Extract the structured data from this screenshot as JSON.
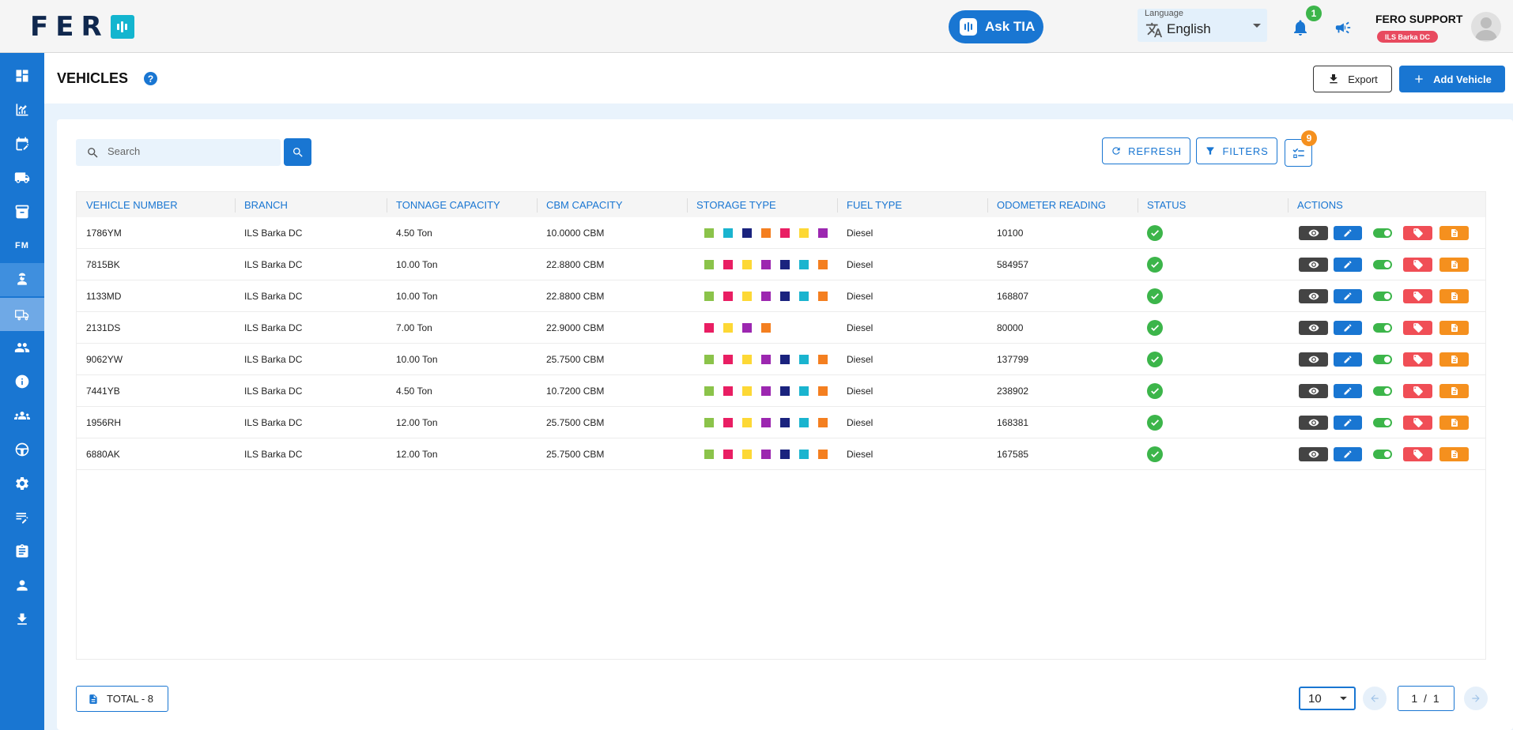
{
  "header": {
    "logo_text": "FER",
    "ask_label": "Ask TIA",
    "language_label": "Language",
    "language_value": "English",
    "notification_count": "1",
    "user_name": "FERO SUPPORT",
    "user_branch": "ILS Barka DC"
  },
  "sidebar": {
    "fm_label": "FM",
    "items": [
      "dashboard-icon",
      "analytics-icon",
      "planner-icon",
      "truck-icon",
      "archive-icon",
      "fm-icon",
      "driver-icon",
      "vehicle-icon",
      "users-icon",
      "info-icon",
      "groups-icon",
      "steering-wheel-icon",
      "settings-icon",
      "edit-note-icon",
      "clipboard-icon",
      "person-icon",
      "download-icon"
    ]
  },
  "page": {
    "title": "VEHICLES",
    "help": "?",
    "export_label": "Export",
    "add_label": "Add Vehicle"
  },
  "toolbar": {
    "search_placeholder": "Search",
    "refresh_label": "REFRESH",
    "filters_label": "FILTERS",
    "columns_badge": "9"
  },
  "table": {
    "columns": [
      "VEHICLE NUMBER",
      "BRANCH",
      "TONNAGE CAPACITY",
      "CBM CAPACITY",
      "STORAGE TYPE",
      "FUEL TYPE",
      "ODOMETER READING",
      "STATUS",
      "ACTIONS"
    ],
    "rows": [
      {
        "vehicle": "1786YM",
        "branch": "ILS Barka DC",
        "tonnage": "4.50 Ton",
        "cbm": "10.0000 CBM",
        "storage": [
          "#8bc34a",
          "#1ab4cf",
          "#1a237e",
          "#f47f20",
          "#e91e63",
          "#fdd835",
          "#9c27b0"
        ],
        "fuel": "Diesel",
        "odometer": "10100"
      },
      {
        "vehicle": "7815BK",
        "branch": "ILS Barka DC",
        "tonnage": "10.00 Ton",
        "cbm": "22.8800 CBM",
        "storage": [
          "#8bc34a",
          "#e91e63",
          "#fdd835",
          "#9c27b0",
          "#1a237e",
          "#1ab4cf",
          "#f47f20"
        ],
        "fuel": "Diesel",
        "odometer": "584957"
      },
      {
        "vehicle": "1133MD",
        "branch": "ILS Barka DC",
        "tonnage": "10.00 Ton",
        "cbm": "22.8800 CBM",
        "storage": [
          "#8bc34a",
          "#e91e63",
          "#fdd835",
          "#9c27b0",
          "#1a237e",
          "#1ab4cf",
          "#f47f20"
        ],
        "fuel": "Diesel",
        "odometer": "168807"
      },
      {
        "vehicle": "2131DS",
        "branch": "ILS Barka DC",
        "tonnage": "7.00 Ton",
        "cbm": "22.9000 CBM",
        "storage": [
          "#e91e63",
          "#fdd835",
          "#9c27b0",
          "#f47f20"
        ],
        "fuel": "Diesel",
        "odometer": "80000"
      },
      {
        "vehicle": "9062YW",
        "branch": "ILS Barka DC",
        "tonnage": "10.00 Ton",
        "cbm": "25.7500 CBM",
        "storage": [
          "#8bc34a",
          "#e91e63",
          "#fdd835",
          "#9c27b0",
          "#1a237e",
          "#1ab4cf",
          "#f47f20"
        ],
        "fuel": "Diesel",
        "odometer": "137799"
      },
      {
        "vehicle": "7441YB",
        "branch": "ILS Barka DC",
        "tonnage": "4.50 Ton",
        "cbm": "10.7200 CBM",
        "storage": [
          "#8bc34a",
          "#e91e63",
          "#fdd835",
          "#9c27b0",
          "#1a237e",
          "#1ab4cf",
          "#f47f20"
        ],
        "fuel": "Diesel",
        "odometer": "238902"
      },
      {
        "vehicle": "1956RH",
        "branch": "ILS Barka DC",
        "tonnage": "12.00 Ton",
        "cbm": "25.7500 CBM",
        "storage": [
          "#8bc34a",
          "#e91e63",
          "#fdd835",
          "#9c27b0",
          "#1a237e",
          "#1ab4cf",
          "#f47f20"
        ],
        "fuel": "Diesel",
        "odometer": "168381"
      },
      {
        "vehicle": "6880AK",
        "branch": "ILS Barka DC",
        "tonnage": "12.00 Ton",
        "cbm": "25.7500 CBM",
        "storage": [
          "#8bc34a",
          "#e91e63",
          "#fdd835",
          "#9c27b0",
          "#1a237e",
          "#1ab4cf",
          "#f47f20"
        ],
        "fuel": "Diesel",
        "odometer": "167585"
      }
    ]
  },
  "footer": {
    "total_label": "TOTAL  - 8",
    "page_size": "10",
    "page_info": "1 / 1"
  },
  "colors": {
    "primary": "#1976d2",
    "success": "#3cb54a",
    "danger": "#f04e56",
    "warning": "#f5901e",
    "brand_dark": "#10284e",
    "brand_accent": "#13b5cf"
  }
}
